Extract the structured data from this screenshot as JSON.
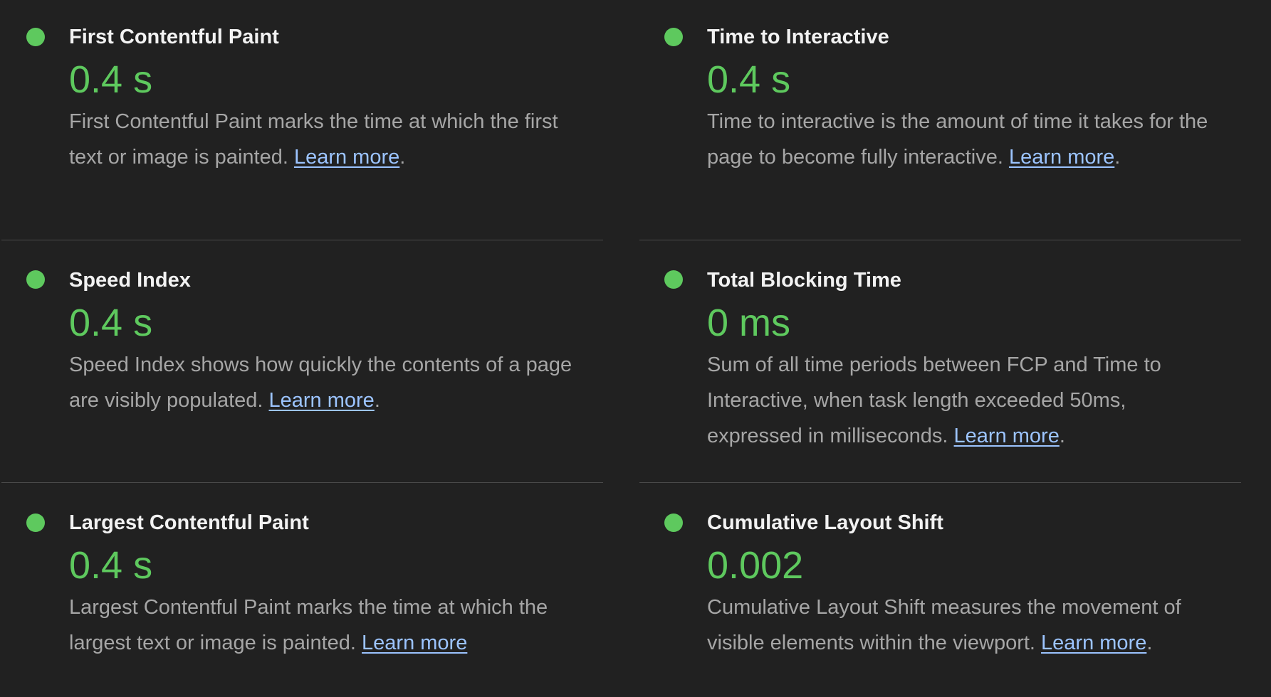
{
  "colors": {
    "background": "#212121",
    "pass": "#5ec95e",
    "title": "#f2f2f2",
    "description": "#a6a6a6",
    "link": "#9cc4ff",
    "divider": "#4a4a4a"
  },
  "metrics": [
    {
      "title": "First Contentful Paint",
      "value": "0.4 s",
      "status": "pass",
      "status_icon": "green-circle-icon",
      "description": "First Contentful Paint marks the time at which the first text or image is painted.",
      "link": "Learn more",
      "trail": "."
    },
    {
      "title": "Time to Interactive",
      "value": "0.4 s",
      "status": "pass",
      "status_icon": "green-circle-icon",
      "description": "Time to interactive is the amount of time it takes for the page to become fully interactive.",
      "link": "Learn more",
      "trail": "."
    },
    {
      "title": "Speed Index",
      "value": "0.4 s",
      "status": "pass",
      "status_icon": "green-circle-icon",
      "description": "Speed Index shows how quickly the contents of a page are visibly populated.",
      "link": "Learn more",
      "trail": "."
    },
    {
      "title": "Total Blocking Time",
      "value": "0 ms",
      "status": "pass",
      "status_icon": "green-circle-icon",
      "description": "Sum of all time periods between FCP and Time to Interactive, when task length exceeded 50ms, expressed in milliseconds.",
      "link": "Learn more",
      "trail": "."
    },
    {
      "title": "Largest Contentful Paint",
      "value": "0.4 s",
      "status": "pass",
      "status_icon": "green-circle-icon",
      "description": "Largest Contentful Paint marks the time at which the largest text or image is painted.",
      "link": "Learn more",
      "trail": ""
    },
    {
      "title": "Cumulative Layout Shift",
      "value": "0.002",
      "status": "pass",
      "status_icon": "green-circle-icon",
      "description": "Cumulative Layout Shift measures the movement of visible elements within the viewport.",
      "link": "Learn more",
      "trail": "."
    }
  ]
}
